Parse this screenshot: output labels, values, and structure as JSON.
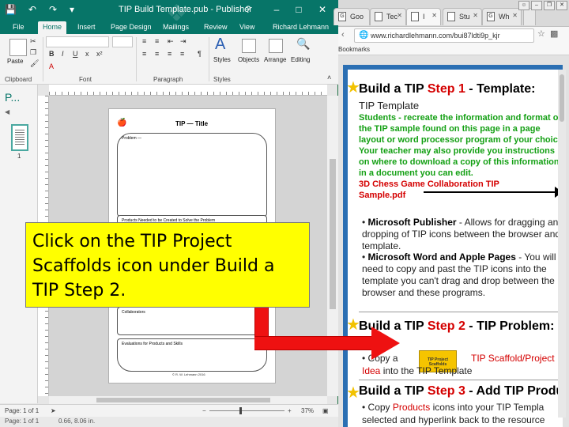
{
  "publisher": {
    "title": "TIP Build Template.pub - Publisher",
    "help": "?",
    "tabs": [
      "File",
      "Home",
      "Insert",
      "Page Design",
      "Mailings",
      "Review",
      "View"
    ],
    "user": "Richard Lehmann",
    "ribbon": {
      "paste": "Paste",
      "clipboard": "Clipboard",
      "font": "Font",
      "paragraph": "Paragraph",
      "styles_btn": "Styles",
      "styles_group": "Styles",
      "objects": "Objects",
      "arrange": "Arrange",
      "editing": "Editing",
      "bold": "B",
      "italic": "I",
      "underline": "U",
      "strike": "x",
      "superscript": "x²",
      "font_color": "A"
    },
    "pages_label": "P...",
    "page_number": "1",
    "document": {
      "title": "TIP   — Title",
      "sections": [
        "Problem —",
        "Products Needed to be Created to Solve the Problem",
        "Collaborators",
        "Evaluations for Products and Skills"
      ],
      "copyright": "© R. W. Lehmann 2016"
    },
    "status": {
      "page": "Page: 1 of 1",
      "zoom": "37%",
      "minus": "−",
      "plus": "+",
      "behind": "Page: 1 of 1",
      "size": "0.66, 8.06 in."
    }
  },
  "browser": {
    "tabs": [
      {
        "label": "Goo",
        "icon": "G"
      },
      {
        "label": "Tec",
        "icon": ""
      },
      {
        "label": "I",
        "icon": ""
      },
      {
        "label": "Stu",
        "icon": ""
      },
      {
        "label": "Wh",
        "icon": "G"
      }
    ],
    "url": "www.richardlehmann.com/bui87ldti9p_kjr",
    "bookmarks": "Bookmarks",
    "content": {
      "step1_prefix": "Build a TIP ",
      "step1_step": "Step 1",
      "step1_suffix": " - Template:",
      "step1_sub": "TIP Template",
      "step1_green": "Students - recreate the information and format of the TIP sample found on this page in a page layout or word processor program of your choice. Your teacher may also provide you instructions on where to download a copy of this information in a document you can edit.",
      "step1_link": "3D Chess Game Collaboration TIP Sample.pdf",
      "bullet1_bold": "Microsoft Publisher",
      "bullet1_rest": " - Allows for dragging and dropping of TIP icons between the browser and template.",
      "bullet2_bold": "Microsoft Word and Apple Pages",
      "bullet2_rest": " - You will need to copy and past the TIP icons into the template you can't drag and drop between the browser and these programs.",
      "step2_prefix": "Build a TIP ",
      "step2_step": "Step 2",
      "step2_suffix": " - TIP Problem:",
      "step2_line_a": "• Copy a",
      "step2_line_b": "TIP Scaffold/Project",
      "step2_line_c": "Idea",
      "step2_line_d": " into the TIP Template",
      "scaffold_icon_label": "TIP Project Scaffolds",
      "step3_prefix": "Build a TIP ",
      "step3_step": "Step 3",
      "step3_suffix": " - Add TIP Produ",
      "step3_line_a": "• Copy ",
      "step3_line_b": "Products",
      "step3_line_c": " icons into your TIP Templa",
      "step3_line2": "selected and hyperlink back to the resource"
    }
  },
  "callout": {
    "text": "Click on the TIP Project Scaffolds icon under Build a TIP Step 2."
  },
  "colors": {
    "publisher_accent": "#077568",
    "callout_bg": "#ffff00",
    "arrow": "#ee1111",
    "green_text": "#14a014",
    "red_text": "#d40000"
  }
}
